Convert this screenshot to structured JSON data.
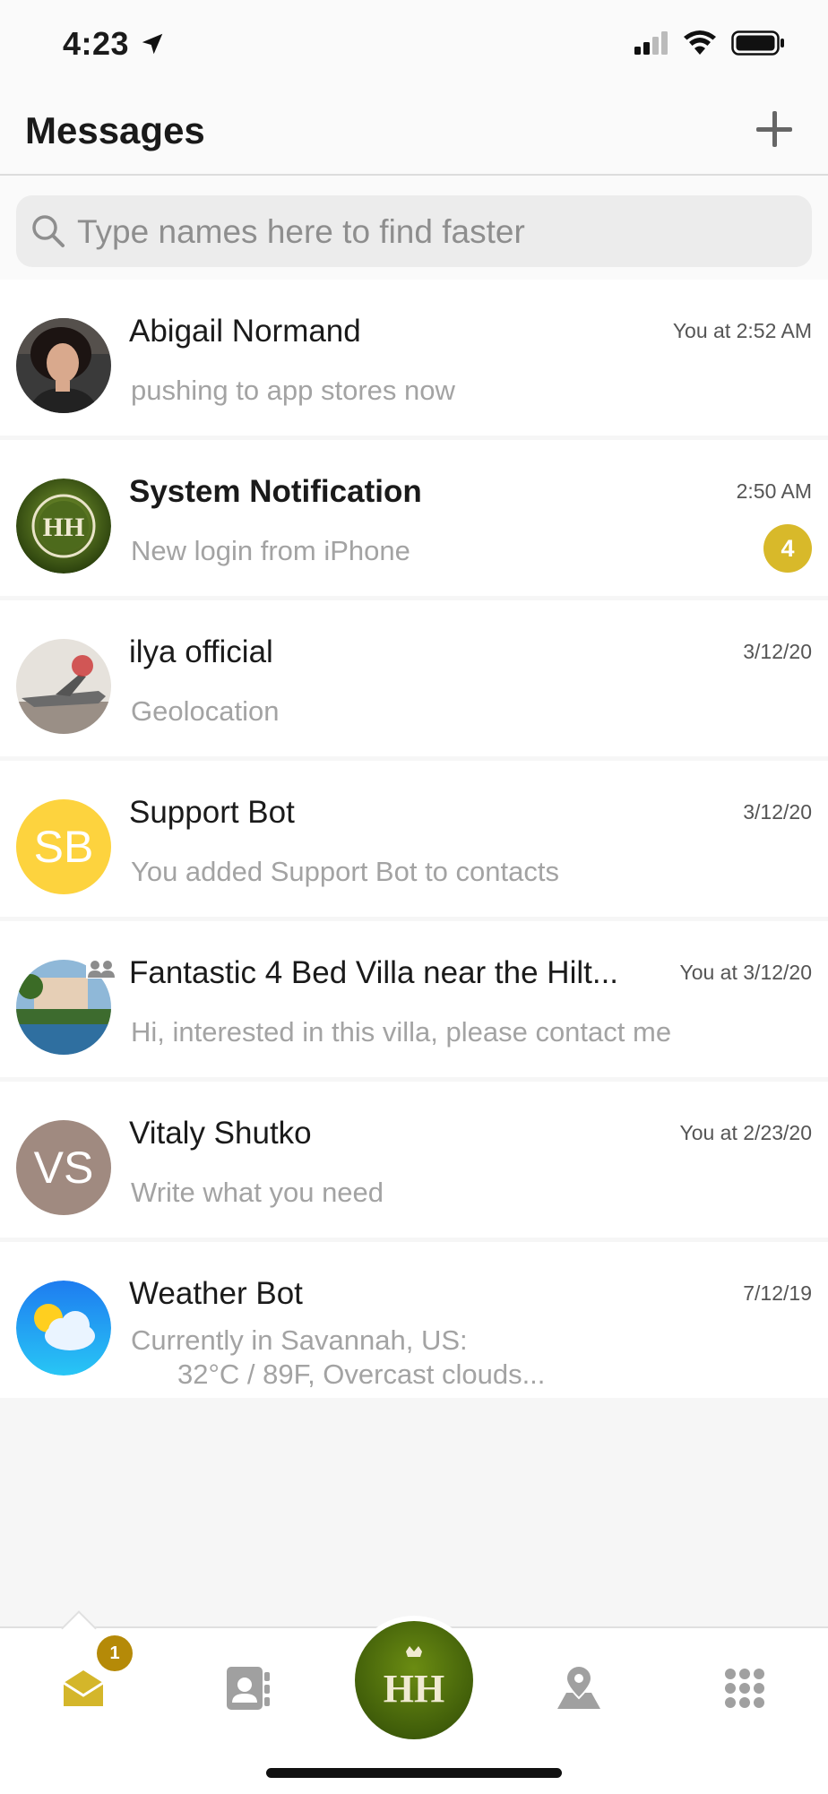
{
  "status_bar": {
    "time": "4:23",
    "icons": [
      "location-arrow-icon",
      "signal-icon",
      "wifi-icon",
      "battery-icon"
    ]
  },
  "header": {
    "title": "Messages",
    "add_icon": "plus-icon"
  },
  "search": {
    "placeholder": "Type names here to find faster"
  },
  "conversations": [
    {
      "name": "Abigail Normand",
      "time": "You at 2:52 AM",
      "preview": "pushing to app stores now",
      "bold": false,
      "avatar": "photo"
    },
    {
      "name": "System Notification",
      "time": "2:50 AM",
      "preview": "New login from iPhone",
      "bold": true,
      "unread": "4",
      "avatar": "logo"
    },
    {
      "name": "ilya official",
      "time": "3/12/20",
      "preview": "Geolocation",
      "bold": false,
      "avatar": "photo"
    },
    {
      "name": "Support Bot",
      "time": "3/12/20",
      "preview": "You added Support Bot to contacts",
      "bold": false,
      "initials": "SB",
      "avatar_color": "#fdd33e"
    },
    {
      "name": "Fantastic 4 Bed Villa near the Hilt...",
      "time": "You at 3/12/20",
      "preview": "Hi, interested in this villa, please contact me",
      "bold": false,
      "avatar": "photo",
      "group": true
    },
    {
      "name": "Vitaly Shutko",
      "time": "You at 2/23/20",
      "preview": "Write what you need",
      "bold": false,
      "initials": "VS",
      "avatar_color": "#a08a80"
    },
    {
      "name": "Weather Bot",
      "time": "7/12/19",
      "preview_line1": "Currently in Savannah, US:",
      "preview_line2": "32°C / 89F, Overcast clouds...",
      "bold": false,
      "avatar": "weather-icon"
    }
  ],
  "tab_bar": {
    "tabs": [
      "messages-icon",
      "contacts-icon",
      "home-logo",
      "map-pin-icon",
      "apps-grid-icon"
    ],
    "messages_badge": "1",
    "active_color": "#d4b62a"
  }
}
